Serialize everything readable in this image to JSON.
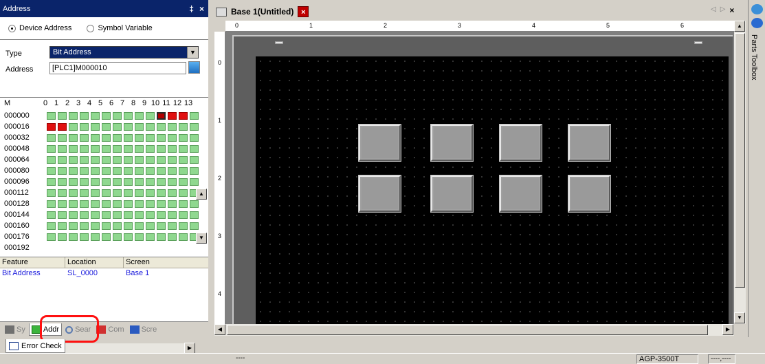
{
  "address_panel": {
    "title": "Address",
    "pin_glyph": "‡",
    "close_glyph": "×",
    "radio_device": "Device Address",
    "radio_symbol": "Symbol Variable",
    "type_label": "Type",
    "type_value": "Bit Address",
    "address_label": "Address",
    "address_value": "[PLC1]M000010"
  },
  "bit_grid": {
    "prefix": "M",
    "columns": [
      "0",
      "1",
      "2",
      "3",
      "4",
      "5",
      "6",
      "7",
      "8",
      "9",
      "10",
      "11",
      "12",
      "13"
    ],
    "rows": [
      "000000",
      "000016",
      "000032",
      "000048",
      "000064",
      "000080",
      "000096",
      "000112",
      "000128",
      "000144",
      "000160",
      "000176",
      "000192"
    ],
    "on_bits": [
      {
        "row": 0,
        "col": 10,
        "state": "selected"
      },
      {
        "row": 0,
        "col": 11,
        "state": "on"
      },
      {
        "row": 0,
        "col": 12,
        "state": "on"
      },
      {
        "row": 1,
        "col": 0,
        "state": "on"
      },
      {
        "row": 1,
        "col": 1,
        "state": "on"
      }
    ]
  },
  "feature_table": {
    "headers": [
      "Feature",
      "Location",
      "Screen"
    ],
    "row": [
      "Bit Address",
      "SL_0000",
      "Base 1"
    ]
  },
  "panel_tabs": [
    {
      "label": "Sy",
      "icon": "system-icon"
    },
    {
      "label": "Addr",
      "icon": "address-grid-icon"
    },
    {
      "label": "Sear",
      "icon": "search-icon"
    },
    {
      "label": "Com",
      "icon": "common-icon"
    },
    {
      "label": "Scre",
      "icon": "screen-list-icon"
    }
  ],
  "error_check_tab": "Error Check",
  "editor": {
    "tab_title": "Base 1(Untitled)",
    "close_glyph": "×",
    "nav_prev": "◁",
    "nav_next": "▷",
    "ruler_h": [
      "0",
      "1",
      "2",
      "3",
      "4",
      "5",
      "6"
    ],
    "ruler_v": [
      "0",
      "1",
      "2",
      "3",
      "4"
    ],
    "canvas_color": "#000000",
    "button_count": 8
  },
  "side_toolbox": {
    "label": "Parts Toolbox"
  },
  "status": {
    "middle": "----",
    "model": "AGP-3500T",
    "coord": "----,----"
  },
  "colors": {
    "titlebar": "#0a246a",
    "bit_off": "#8fd88f",
    "bit_on": "#e01010",
    "highlight": "#ff1010",
    "link_text": "#1a1adc"
  }
}
